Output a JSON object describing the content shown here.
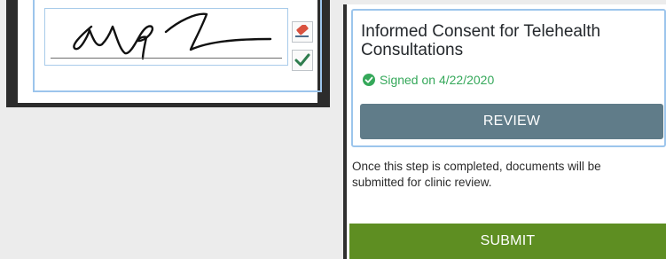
{
  "signature_pad": {
    "clear_icon": "eraser-icon",
    "accept_icon": "checkmark-icon",
    "colors": {
      "frame": "#2c2c2c",
      "border": "#9cc5ec",
      "ink": "#111111",
      "accept": "#2f7d4f"
    }
  },
  "consent": {
    "title": "Informed Consent for Telehealth Consultations",
    "status_icon": "check-circle-icon",
    "signed_text": "Signed on 4/22/2020",
    "review_label": "REVIEW",
    "instructions": "Once this step is completed, documents will be submitted for clinic review.",
    "submit_label": "SUBMIT",
    "colors": {
      "signed": "#35a85a",
      "review_button": "#607c89",
      "submit_button": "#5e8e22",
      "card_border": "#9cc5ec"
    }
  }
}
